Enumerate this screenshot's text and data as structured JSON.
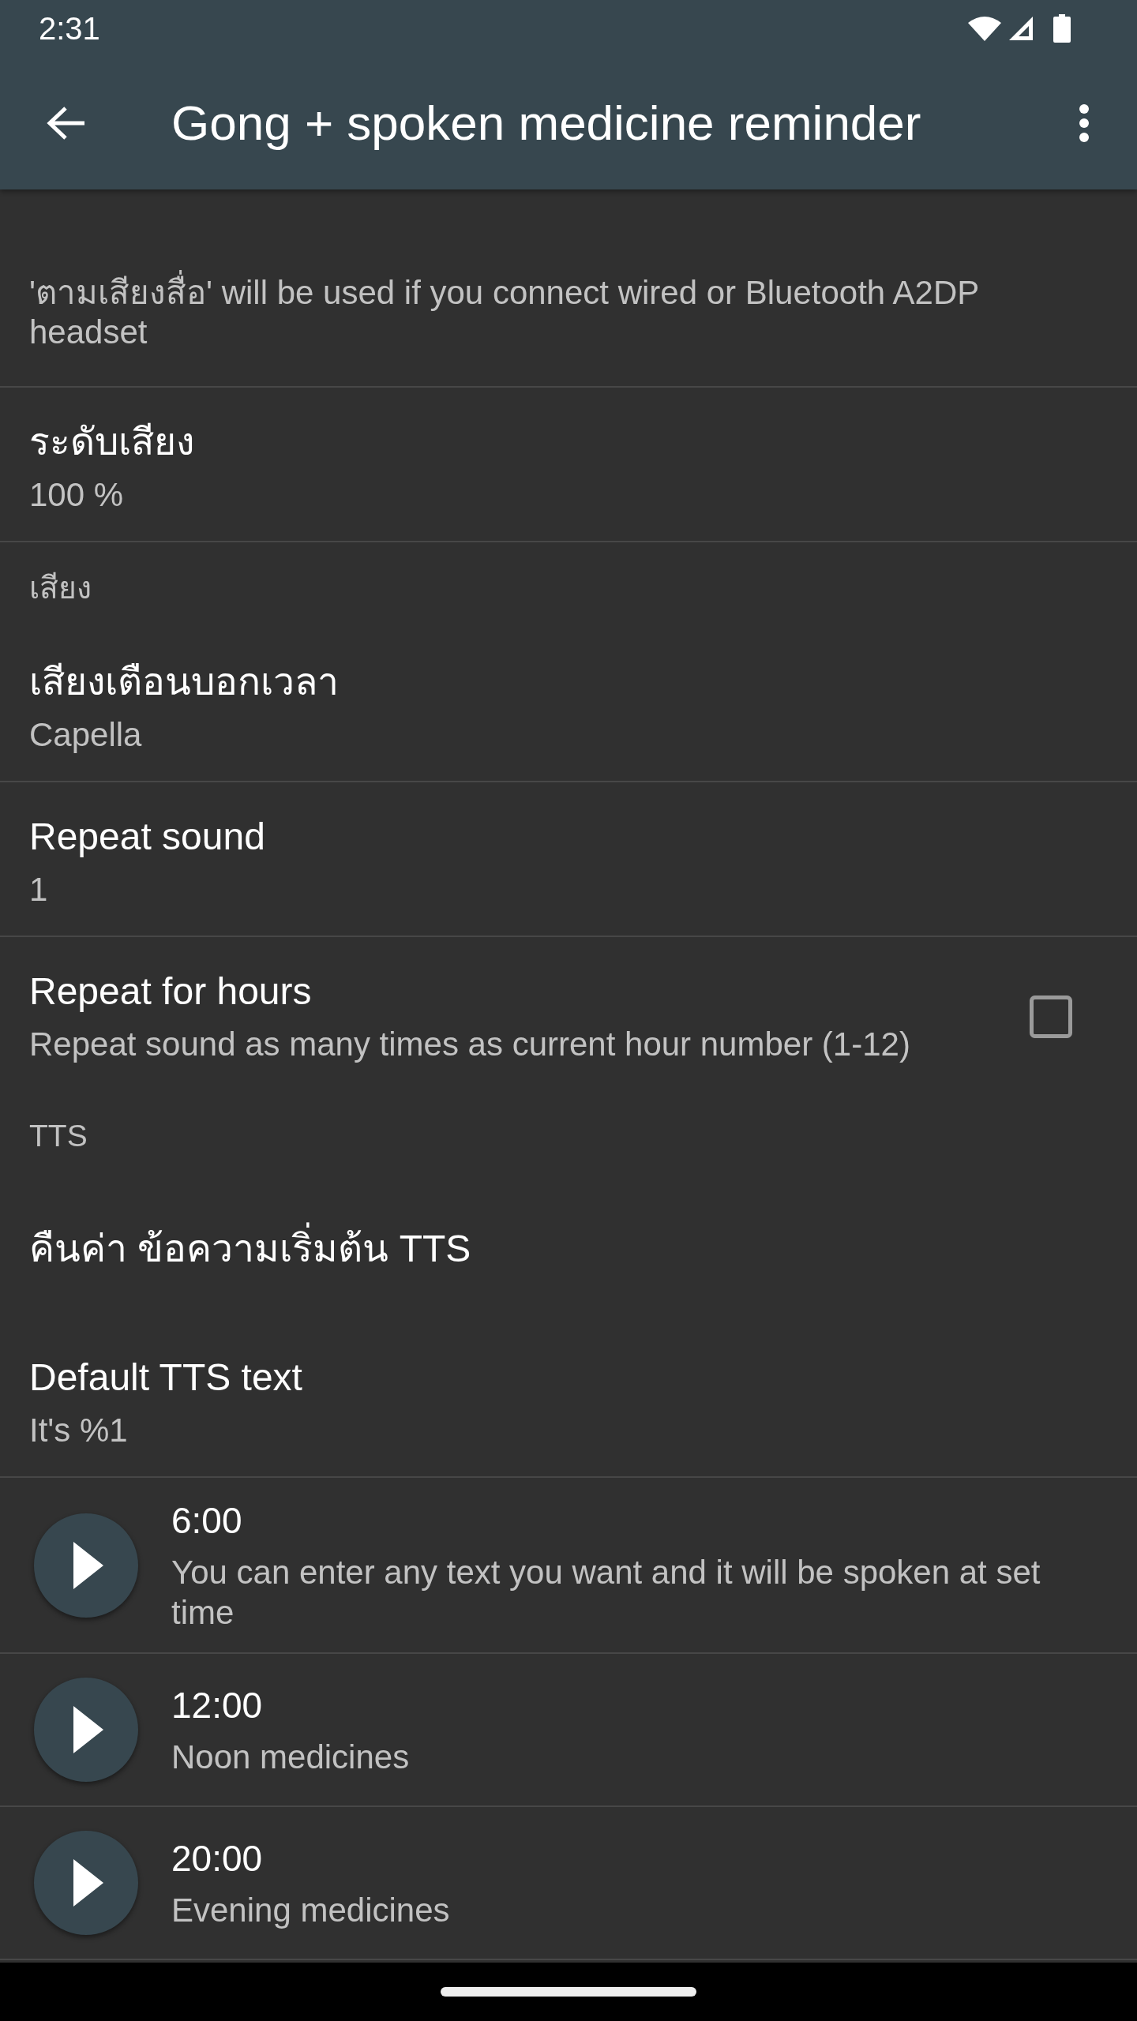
{
  "status_bar": {
    "time": "2:31"
  },
  "toolbar": {
    "title": "Gong + spoken medicine reminder"
  },
  "preferences": [
    {
      "kind": "note",
      "summary": "'ตามเสียงสื่อ' will be used if you connect wired or Bluetooth A2DP headset",
      "divider": true
    },
    {
      "kind": "item",
      "title": "ระดับเสียง",
      "summary": "100 %",
      "divider": true
    },
    {
      "kind": "category",
      "title": "เสียง",
      "divider": false
    },
    {
      "kind": "item",
      "title": "เสียงเตือนบอกเวลา",
      "summary": "Capella",
      "divider": true
    },
    {
      "kind": "item",
      "title": "Repeat sound",
      "summary": "1",
      "divider": true
    },
    {
      "kind": "checkbox",
      "title": "Repeat for hours",
      "summary": "Repeat sound as many times as current hour number (1-12)",
      "checked": false,
      "divider": false
    },
    {
      "kind": "category",
      "title": "TTS",
      "divider": false
    },
    {
      "kind": "action",
      "title": "คืนค่า ข้อความเริ่มต้น TTS",
      "divider": false
    },
    {
      "kind": "item",
      "title": "Default TTS text",
      "summary": "It's %1",
      "divider": true
    }
  ],
  "reminders": [
    {
      "time": "6:00",
      "text": "You can enter any text you want and it will be spoken at set time"
    },
    {
      "time": "12:00",
      "text": "Noon medicines"
    },
    {
      "time": "20:00",
      "text": "Evening medicines"
    }
  ]
}
